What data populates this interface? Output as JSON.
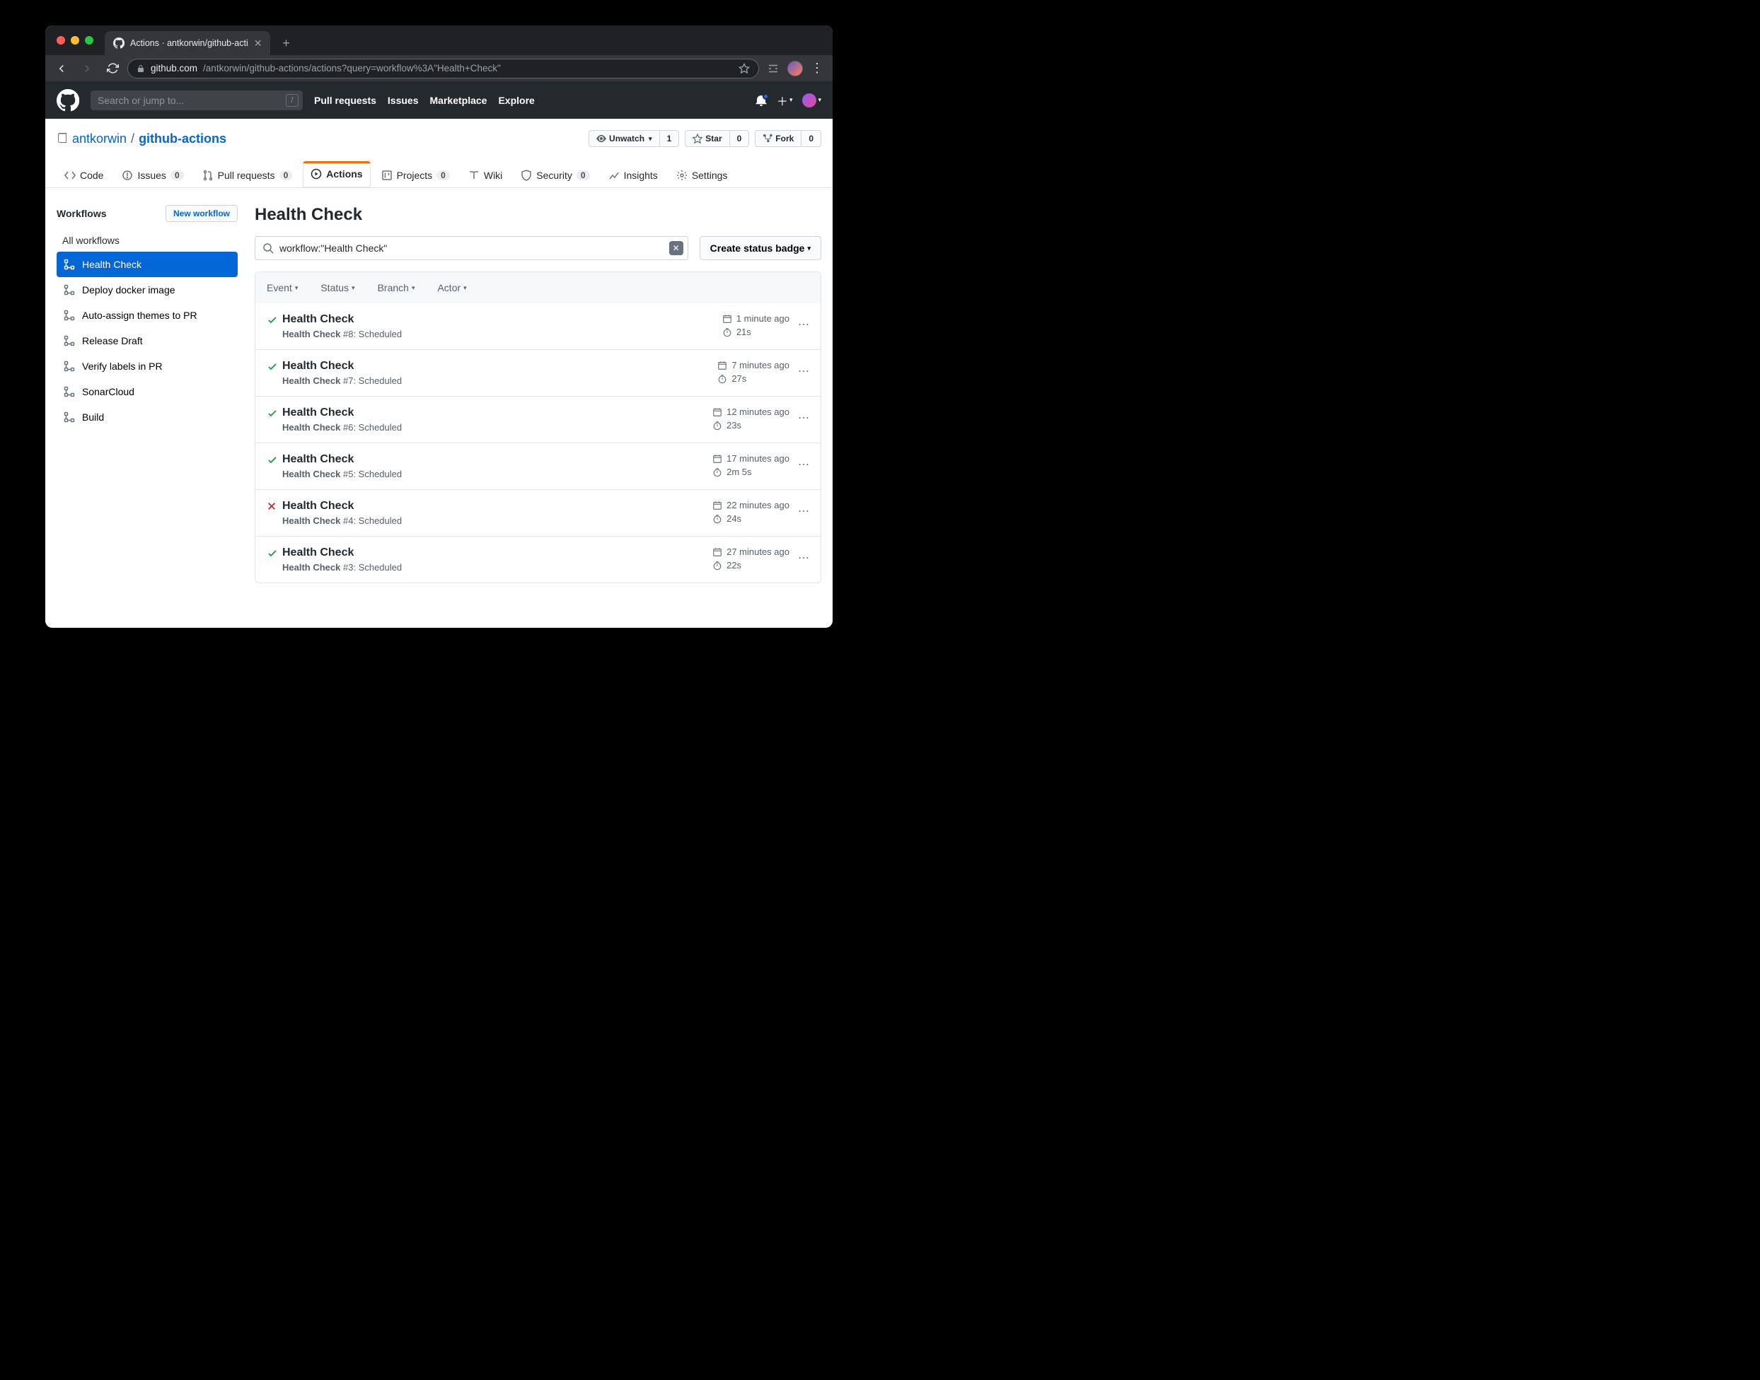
{
  "browser": {
    "tab_title": "Actions · antkorwin/github-acti",
    "url_host": "github.com",
    "url_path": "/antkorwin/github-actions/actions?query=workflow%3A\"Health+Check\""
  },
  "gh_header": {
    "search_placeholder": "Search or jump to...",
    "nav": [
      "Pull requests",
      "Issues",
      "Marketplace",
      "Explore"
    ]
  },
  "repo": {
    "owner": "antkorwin",
    "name": "github-actions",
    "watch_label": "Unwatch",
    "watch_count": "1",
    "star_label": "Star",
    "star_count": "0",
    "fork_label": "Fork",
    "fork_count": "0"
  },
  "tabs": {
    "code": "Code",
    "issues": "Issues",
    "issues_count": "0",
    "pulls": "Pull requests",
    "pulls_count": "0",
    "actions": "Actions",
    "projects": "Projects",
    "projects_count": "0",
    "wiki": "Wiki",
    "security": "Security",
    "security_count": "0",
    "insights": "Insights",
    "settings": "Settings"
  },
  "sidebar": {
    "title": "Workflows",
    "new_btn": "New workflow",
    "all": "All workflows",
    "items": [
      {
        "label": "Health Check"
      },
      {
        "label": "Deploy docker image"
      },
      {
        "label": "Auto-assign themes to PR"
      },
      {
        "label": "Release Draft"
      },
      {
        "label": "Verify labels in PR"
      },
      {
        "label": "SonarCloud"
      },
      {
        "label": "Build"
      }
    ]
  },
  "page": {
    "heading": "Health Check",
    "filter_value": "workflow:\"Health Check\"",
    "status_badge_btn": "Create status badge",
    "columns": {
      "event": "Event",
      "status": "Status",
      "branch": "Branch",
      "actor": "Actor"
    }
  },
  "runs": [
    {
      "status": "success",
      "title": "Health Check",
      "workflow": "Health Check",
      "num": "#8",
      "trigger": "Scheduled",
      "time": "1 minute ago",
      "duration": "21s"
    },
    {
      "status": "success",
      "title": "Health Check",
      "workflow": "Health Check",
      "num": "#7",
      "trigger": "Scheduled",
      "time": "7 minutes ago",
      "duration": "27s"
    },
    {
      "status": "success",
      "title": "Health Check",
      "workflow": "Health Check",
      "num": "#6",
      "trigger": "Scheduled",
      "time": "12 minutes ago",
      "duration": "23s"
    },
    {
      "status": "success",
      "title": "Health Check",
      "workflow": "Health Check",
      "num": "#5",
      "trigger": "Scheduled",
      "time": "17 minutes ago",
      "duration": "2m 5s"
    },
    {
      "status": "failure",
      "title": "Health Check",
      "workflow": "Health Check",
      "num": "#4",
      "trigger": "Scheduled",
      "time": "22 minutes ago",
      "duration": "24s"
    },
    {
      "status": "success",
      "title": "Health Check",
      "workflow": "Health Check",
      "num": "#3",
      "trigger": "Scheduled",
      "time": "27 minutes ago",
      "duration": "22s"
    }
  ]
}
